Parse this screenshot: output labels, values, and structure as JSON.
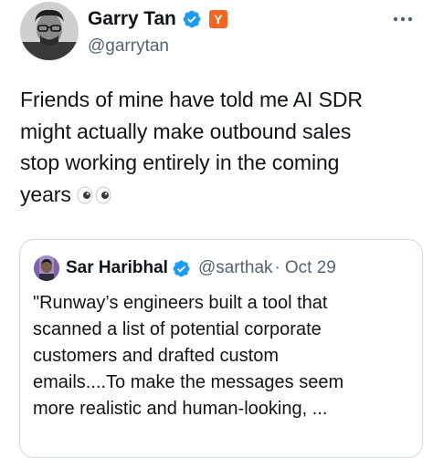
{
  "author": {
    "display_name": "Garry Tan",
    "handle": "@garrytan",
    "verified_icon": "verified-badge-icon",
    "affiliate_badge": "Y",
    "affiliate_color": "#f26522"
  },
  "tweet": {
    "lines": [
      "Friends of mine have told me AI SDR",
      "might actually make outbound sales",
      "stop working entirely in the coming",
      "years"
    ],
    "emoji": "eyes-emoji"
  },
  "quoted_tweet": {
    "display_name": "Sar Haribhal",
    "handle": "@sarthak",
    "separator": "·",
    "date": "Oct 29",
    "lines": [
      "\"Runway’s engineers built a tool that",
      "scanned a list of potential corporate",
      "customers and drafted custom",
      "emails....To make the messages seem",
      "more realistic and human-looking, ..."
    ]
  },
  "colors": {
    "text": "#0f1419",
    "secondary": "#536471",
    "verified": "#1d9bf0",
    "border": "#cfd9de"
  }
}
